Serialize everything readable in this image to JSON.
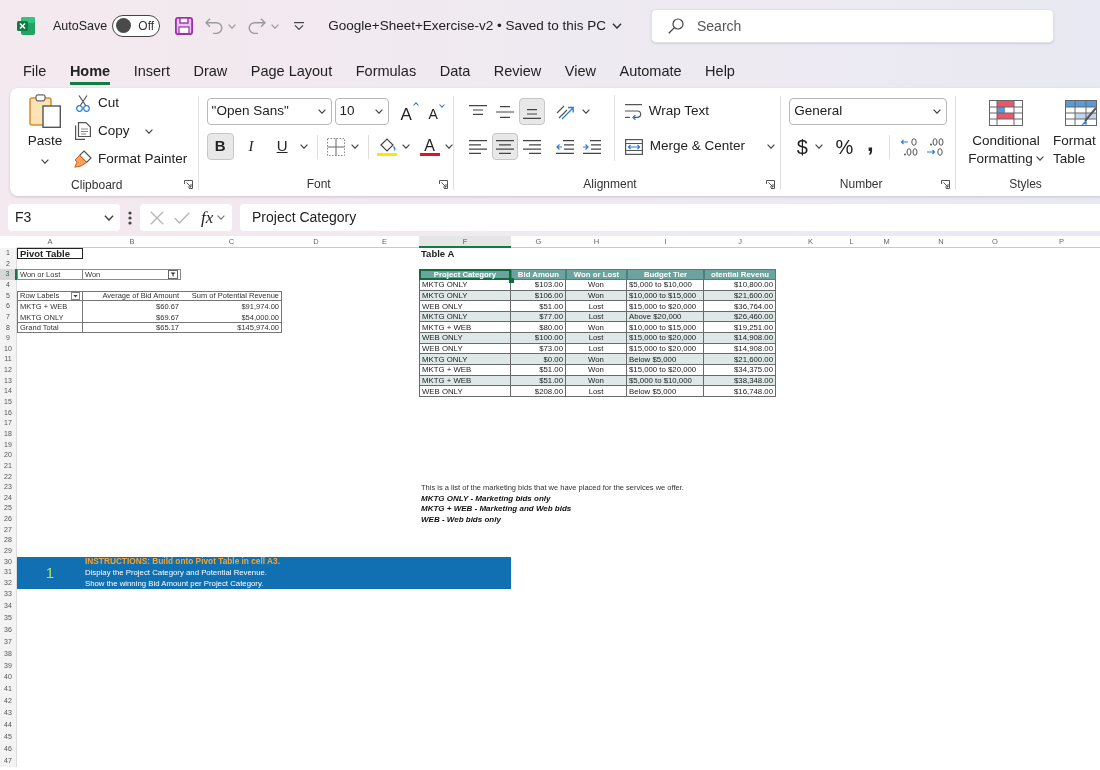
{
  "title_bar": {
    "autosave_label": "AutoSave",
    "autosave": {
      "on": false,
      "label": "Off"
    },
    "document_title": "Google+Sheet+Exercise-v2 • Saved to this PC",
    "search": {
      "placeholder": "Search"
    }
  },
  "menu_tabs": [
    {
      "label": "File",
      "selected": false
    },
    {
      "label": "Home",
      "selected": true
    },
    {
      "label": "Insert",
      "selected": false
    },
    {
      "label": "Draw",
      "selected": false
    },
    {
      "label": "Page Layout",
      "selected": false
    },
    {
      "label": "Formulas",
      "selected": false
    },
    {
      "label": "Data",
      "selected": false
    },
    {
      "label": "Review",
      "selected": false
    },
    {
      "label": "View",
      "selected": false
    },
    {
      "label": "Automate",
      "selected": false
    },
    {
      "label": "Help",
      "selected": false
    }
  ],
  "ribbon": {
    "clipboard": {
      "label": "Clipboard",
      "paste": "Paste",
      "cut": "Cut",
      "copy": "Copy",
      "format_painter": "Format Painter"
    },
    "font": {
      "label": "Font",
      "font_name": "\"Open Sans\"",
      "font_size": "10",
      "grow_font": "A",
      "shrink_font": "A",
      "styles": [
        {
          "kind": "bold",
          "label": "B",
          "on": true
        },
        {
          "kind": "italic",
          "label": "I",
          "on": false
        },
        {
          "kind": "underline",
          "label": "U",
          "on": false
        }
      ],
      "font_color": "A"
    },
    "alignment": {
      "label": "Alignment",
      "vertical": [
        {
          "kind": "top",
          "selected": false
        },
        {
          "kind": "middle",
          "selected": false
        },
        {
          "kind": "bottom",
          "selected": true
        }
      ],
      "horizontal": [
        {
          "kind": "left",
          "selected": false
        },
        {
          "kind": "center",
          "selected": true
        },
        {
          "kind": "right",
          "selected": false
        }
      ],
      "wrap_text": "Wrap Text",
      "merge_center": "Merge & Center"
    },
    "number": {
      "label": "Number",
      "format": "General",
      "symbols": [
        {
          "kind": "currency",
          "label": "$"
        },
        {
          "kind": "percent",
          "label": "%"
        },
        {
          "kind": "comma",
          "label": ","
        }
      ]
    },
    "styles": {
      "label": "Styles",
      "conditional_formatting": [
        "Conditional",
        "Formatting"
      ],
      "format_as_table": [
        "Format",
        "Table"
      ]
    }
  },
  "formula_bar": {
    "name_box": "F3",
    "function_label": "fx",
    "formula": "Project Category"
  },
  "sheet": {
    "columns": [
      {
        "label": "A",
        "selected": false
      },
      {
        "label": "B",
        "selected": false
      },
      {
        "label": "C",
        "selected": false
      },
      {
        "label": "D",
        "selected": false
      },
      {
        "label": "E",
        "selected": false
      },
      {
        "label": "F",
        "selected": true
      },
      {
        "label": "G",
        "selected": false
      },
      {
        "label": "H",
        "selected": false
      },
      {
        "label": "I",
        "selected": false
      },
      {
        "label": "J",
        "selected": false
      },
      {
        "label": "K",
        "selected": false
      },
      {
        "label": "L",
        "selected": false
      },
      {
        "label": "M",
        "selected": false
      },
      {
        "label": "N",
        "selected": false
      },
      {
        "label": "O",
        "selected": false
      },
      {
        "label": "P",
        "selected": false
      }
    ],
    "rows": [
      {
        "label": "1",
        "selected": false
      },
      {
        "label": "2",
        "selected": false
      },
      {
        "label": "3",
        "selected": true
      },
      {
        "label": "4",
        "selected": false
      },
      {
        "label": "5",
        "selected": false
      },
      {
        "label": "6",
        "selected": false
      },
      {
        "label": "7",
        "selected": false
      },
      {
        "label": "8",
        "selected": false
      },
      {
        "label": "9",
        "selected": false
      },
      {
        "label": "10",
        "selected": false
      },
      {
        "label": "11",
        "selected": false
      },
      {
        "label": "12",
        "selected": false
      },
      {
        "label": "13",
        "selected": false
      },
      {
        "label": "14",
        "selected": false
      },
      {
        "label": "15",
        "selected": false
      },
      {
        "label": "16",
        "selected": false
      },
      {
        "label": "17",
        "selected": false
      },
      {
        "label": "18",
        "selected": false
      },
      {
        "label": "19",
        "selected": false
      },
      {
        "label": "20",
        "selected": false
      },
      {
        "label": "21",
        "selected": false
      },
      {
        "label": "22",
        "selected": false
      },
      {
        "label": "23",
        "selected": false
      },
      {
        "label": "24",
        "selected": false
      },
      {
        "label": "25",
        "selected": false
      },
      {
        "label": "26",
        "selected": false
      },
      {
        "label": "27",
        "selected": false
      },
      {
        "label": "28",
        "selected": false
      },
      {
        "label": "29",
        "selected": false
      },
      {
        "label": "30",
        "selected": false
      },
      {
        "label": "31",
        "selected": false
      },
      {
        "label": "32",
        "selected": false
      },
      {
        "label": "33",
        "selected": false
      },
      {
        "label": "34",
        "selected": false
      },
      {
        "label": "35",
        "selected": false
      },
      {
        "label": "36",
        "selected": false
      },
      {
        "label": "37",
        "selected": false
      },
      {
        "label": "38",
        "selected": false
      },
      {
        "label": "39",
        "selected": false
      },
      {
        "label": "40",
        "selected": false
      },
      {
        "label": "41",
        "selected": false
      },
      {
        "label": "42",
        "selected": false
      },
      {
        "label": "43",
        "selected": false
      },
      {
        "label": "44",
        "selected": false
      },
      {
        "label": "45",
        "selected": false
      },
      {
        "label": "46",
        "selected": false
      },
      {
        "label": "47",
        "selected": false
      }
    ],
    "pivot": {
      "title": "Pivot Table",
      "filter": {
        "field": "Won or Lost",
        "value": "Won"
      },
      "headers": [
        "Row Labels",
        "Average of Bid Amount",
        "Sum of Potential Revenue"
      ],
      "rows": [
        [
          "MKTG + WEB",
          "$60.67",
          "$91,974.00"
        ],
        [
          "MKTG ONLY",
          "$69.67",
          "$54,000.00"
        ]
      ],
      "total": [
        "Grand Total",
        "$65.17",
        "$145,974.00"
      ]
    },
    "table_a": {
      "title": "Table A",
      "headers": [
        {
          "text": "Project Category",
          "selected": true
        },
        {
          "text": "Bid Amoun",
          "selected": false
        },
        {
          "text": "Won or Lost",
          "selected": false
        },
        {
          "text": "Budget Tier",
          "selected": false
        },
        {
          "text": "otential Revenu",
          "selected": false
        }
      ],
      "rows": [
        [
          "MKTG ONLY",
          "$103.00",
          "Won",
          "$5,000 to $10,000",
          "$10,800.00"
        ],
        [
          "MKTG ONLY",
          "$106.00",
          "Won",
          "$10,000 to $15,000",
          "$21,600.00"
        ],
        [
          "WEB ONLY",
          "$51.00",
          "Lost",
          "$15,000 to $20,000",
          "$36,764.00"
        ],
        [
          "MKTG ONLY",
          "$77.00",
          "Lost",
          "Above $20,000",
          "$26,460.00"
        ],
        [
          "MKTG + WEB",
          "$80.00",
          "Won",
          "$10,000 to $15,000",
          "$19,251.00"
        ],
        [
          "WEB ONLY",
          "$100.00",
          "Lost",
          "$15,000 to $20,000",
          "$14,908.00"
        ],
        [
          "WEB ONLY",
          "$73.00",
          "Lost",
          "$15,000 to $20,000",
          "$14,908.00"
        ],
        [
          "MKTG ONLY",
          "$0.00",
          "Won",
          "Below $5,000",
          "$21,600.00"
        ],
        [
          "MKTG + WEB",
          "$51.00",
          "Won",
          "$15,000 to $20,000",
          "$34,375.00"
        ],
        [
          "MKTG + WEB",
          "$51.00",
          "Won",
          "$5,000 to $10,000",
          "$38,348.00"
        ],
        [
          "WEB ONLY",
          "$208.00",
          "Lost",
          "Below $5,000",
          "$16,748.00"
        ]
      ]
    },
    "notes": [
      {
        "kind": "plain",
        "text": "This is a list of the marketing bids that we have placed for the services we offer."
      },
      {
        "kind": "emphasis",
        "text": "MKTG ONLY - Marketing bids only"
      },
      {
        "kind": "emphasis",
        "text": "MKTG + WEB - Marketing and Web bids"
      },
      {
        "kind": "emphasis",
        "text": "WEB - Web bids only"
      }
    ],
    "instructions": {
      "step": "1",
      "heading": "INSTRUCTIONS: Build onto Pivot Table in cell A3.",
      "lines": [
        "Display the Project Category and Potential Revenue.",
        "Show the winning Bid Amount per Project Category."
      ]
    }
  }
}
